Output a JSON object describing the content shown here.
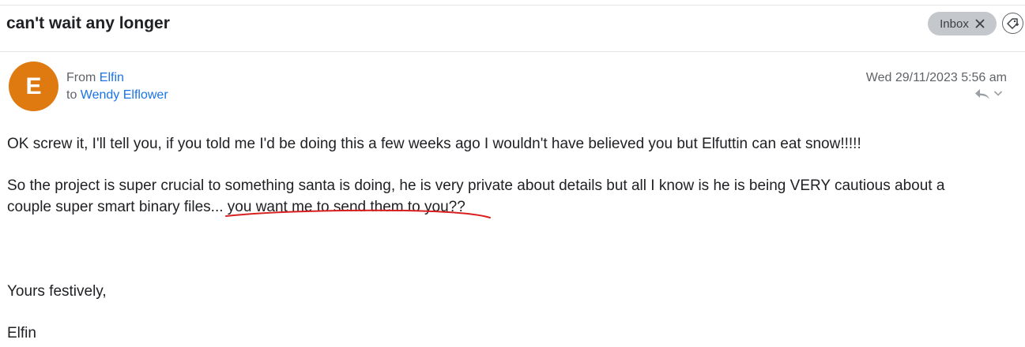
{
  "email": {
    "subject": "can't wait any longer",
    "labels": [
      {
        "name": "Inbox"
      }
    ],
    "from_prefix": "From",
    "from_name": "Elfin",
    "to_prefix": "to",
    "to_name": "Wendy Elflower",
    "avatar_letter": "E",
    "date": "Wed 29/11/2023 5:56 am",
    "body": {
      "paragraph1": "OK screw it, I'll tell you, if you told me I'd be doing this a few weeks ago I wouldn't have believed you but Elfuttin can eat snow!!!!!",
      "paragraph2_line1": "So the project is super crucial to something santa is doing, he is very private about details but all I know is he is being VERY cautious about a",
      "paragraph2_line2": "couple super smart binary files... you want me to send them to you??",
      "closing": "Yours festively,",
      "signature": "Elfin"
    }
  },
  "colors": {
    "avatar_bg": "#de7a10",
    "link": "#1a73e8",
    "annotation_underline": "#d92020",
    "chip_bg": "#c4c7cc"
  },
  "icons": {
    "close": "close-icon",
    "tag": "tag-icon",
    "reply": "reply-icon",
    "more": "chevron-down-icon"
  }
}
